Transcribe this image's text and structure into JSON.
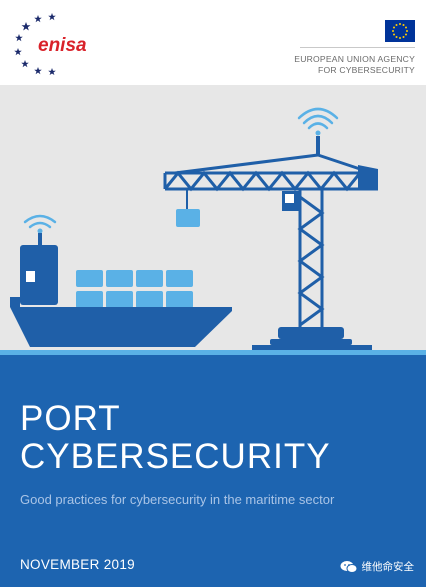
{
  "header": {
    "logo_text": "enisa",
    "agency_line1": "EUROPEAN UNION AGENCY",
    "agency_line2": "FOR CYBERSECURITY"
  },
  "icons": {
    "logo": "enisa-star-arc-logo",
    "flag": "eu-flag-icon",
    "ship": "cargo-ship-icon",
    "crane": "port-crane-icon",
    "watermark": "chat-bubble-icon"
  },
  "colors": {
    "brand_blue": "#1d64b0",
    "illustration_blue": "#1f5fa8",
    "container_light": "#5ab1e6",
    "logo_red": "#d9222a",
    "logo_navy": "#1b2a6b"
  },
  "cover": {
    "title_line1": "PORT",
    "title_line2": "CYBERSECURITY",
    "subtitle": "Good practices for cybersecurity in the maritime sector",
    "date": "NOVEMBER 2019"
  },
  "watermark": {
    "text": "维他命安全"
  }
}
